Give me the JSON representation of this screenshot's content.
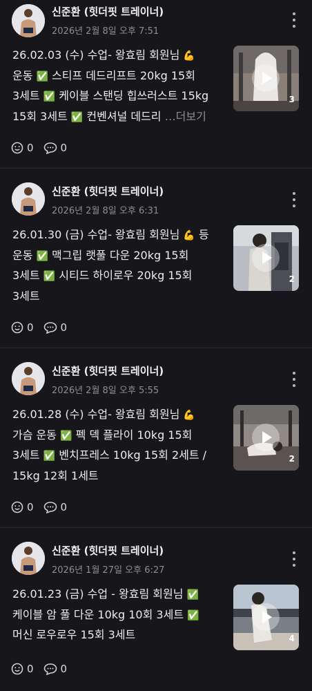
{
  "see_more_label": "…더보기",
  "posts": [
    {
      "author": "신준환 (힛더핏 트레이너)",
      "date": "2026년 2월 8일 오후 7:51",
      "lines": [
        [
          "26.02.03 (수) 수업- 왕효림 회원님 ",
          "💪"
        ],
        [
          "운동 ",
          "✅",
          " 스티프 데드리프트 20kg 15회"
        ],
        [
          "3세트 ",
          "✅",
          " 케이블 스탠딩 힙쓰러스트 15kg"
        ],
        [
          "15회 3세트 ",
          "✅",
          " 컨벤셔널 데드리 "
        ]
      ],
      "truncated": true,
      "media_count": "3",
      "reactions": "0",
      "comments": "0"
    },
    {
      "author": "신준환 (힛더핏 트레이너)",
      "date": "2026년 2월 8일 오후 6:31",
      "lines": [
        [
          "26.01.30 (금) 수업- 왕효림 회원님 ",
          "💪",
          " 등"
        ],
        [
          "운동 ",
          "✅",
          " 맥그립 랫풀 다운 20kg 15회"
        ],
        [
          "3세트 ",
          "✅",
          " 시티드 하이로우 20kg 15회"
        ],
        [
          "3세트",
          "",
          ""
        ]
      ],
      "truncated": false,
      "media_count": "2",
      "reactions": "0",
      "comments": "0"
    },
    {
      "author": "신준환 (힛더핏 트레이너)",
      "date": "2026년 2월 8일 오후 5:55",
      "lines": [
        [
          "26.01.28 (수) 수업- 왕효림 회원님 ",
          "💪"
        ],
        [
          "가슴 운동 ",
          "✅",
          " 펙 덱 플라이 10kg 15회"
        ],
        [
          "3세트 ",
          "✅",
          " 벤치프레스 10kg 15회 2세트 /"
        ],
        [
          "15kg 12회 1세트",
          "",
          ""
        ]
      ],
      "truncated": false,
      "media_count": "2",
      "reactions": "0",
      "comments": "0"
    },
    {
      "author": "신준환 (힛더핏 트레이너)",
      "date": "2026년 1월 27일 오후 6:27",
      "lines": [
        [
          "26.01.23 (금) 수업 - 왕효림 회원님 ",
          "✅"
        ],
        [
          "케이블 암 풀 다운 10kg 10회 3세트 ",
          "✅"
        ],
        [
          "머신 로우로우 15회 3세트",
          "",
          ""
        ]
      ],
      "truncated": false,
      "media_count": "4",
      "reactions": "0",
      "comments": "0"
    }
  ]
}
